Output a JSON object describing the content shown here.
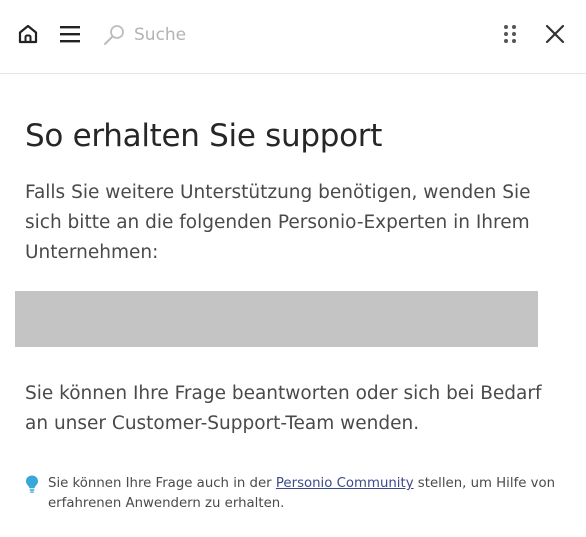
{
  "header": {
    "search_placeholder": "Suche"
  },
  "main": {
    "title": "So erhalten Sie support",
    "intro": "Falls Sie weitere Unterstützung benötigen, wenden Sie sich bitte an die folgenden Personio-Experten in Ihrem Unternehmen:",
    "support_text": "Sie können Ihre Frage beantworten oder sich bei Bedarf an unser Customer-Support-Team wenden.",
    "hint": {
      "prefix": "Sie können Ihre Frage auch in der ",
      "link_label": "Personio Community",
      "suffix": " stellen, um Hilfe von erfahrenen Anwendern zu erhalten."
    }
  },
  "icons": {
    "home": "home-icon",
    "menu": "menu-icon",
    "search": "search-icon",
    "grip": "drag-handle-icon",
    "close": "close-icon",
    "hint": "lightbulb-icon"
  },
  "colors": {
    "placeholder_block": "#c4c4c4",
    "link": "#3b4a8a",
    "hint_icon": "#3aa7d8"
  }
}
